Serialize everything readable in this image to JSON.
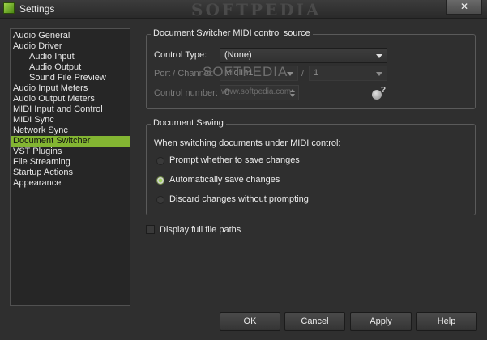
{
  "window": {
    "title": "Settings",
    "close_glyph": "✕",
    "watermark": "SOFTPEDIA"
  },
  "sidebar": {
    "items": [
      {
        "label": "Audio General",
        "level": 0,
        "selected": false
      },
      {
        "label": "Audio Driver",
        "level": 0,
        "selected": false
      },
      {
        "label": "Audio Input",
        "level": 1,
        "selected": false
      },
      {
        "label": "Audio Output",
        "level": 1,
        "selected": false
      },
      {
        "label": "Sound File Preview",
        "level": 1,
        "selected": false
      },
      {
        "label": "Audio Input Meters",
        "level": 0,
        "selected": false
      },
      {
        "label": "Audio Output Meters",
        "level": 0,
        "selected": false
      },
      {
        "label": "MIDI Input and Control",
        "level": 0,
        "selected": false
      },
      {
        "label": "MIDI Sync",
        "level": 0,
        "selected": false
      },
      {
        "label": "Network Sync",
        "level": 0,
        "selected": false
      },
      {
        "label": "Document Switcher",
        "level": 0,
        "selected": true
      },
      {
        "label": "VST Plugins",
        "level": 0,
        "selected": false
      },
      {
        "label": "File Streaming",
        "level": 0,
        "selected": false
      },
      {
        "label": "Startup Actions",
        "level": 0,
        "selected": false
      },
      {
        "label": "Appearance",
        "level": 0,
        "selected": false
      }
    ]
  },
  "midi_source": {
    "title": "Document Switcher MIDI control source",
    "control_type_label": "Control Type:",
    "control_type_value": "(None)",
    "port_channel_label": "Port / Channel:",
    "port_value": "MidiIn1",
    "separator": "/",
    "channel_value": "1",
    "control_number_label": "Control number:",
    "control_number_value": "0",
    "watermark_title": "SOFTPEDIA",
    "watermark_url": "www.softpedia.com",
    "learn_mark": "?"
  },
  "saving": {
    "title": "Document Saving",
    "prompt": "When switching documents under MIDI control:",
    "options": [
      {
        "label": "Prompt whether to save changes",
        "checked": false
      },
      {
        "label": "Automatically save changes",
        "checked": true
      },
      {
        "label": "Discard changes without prompting",
        "checked": false
      }
    ]
  },
  "display_full_paths": {
    "label": "Display full file paths",
    "checked": false
  },
  "buttons": {
    "ok": "OK",
    "cancel": "Cancel",
    "apply": "Apply",
    "help": "Help"
  },
  "colors": {
    "accent": "#83b532",
    "background": "#2f2f2f"
  }
}
